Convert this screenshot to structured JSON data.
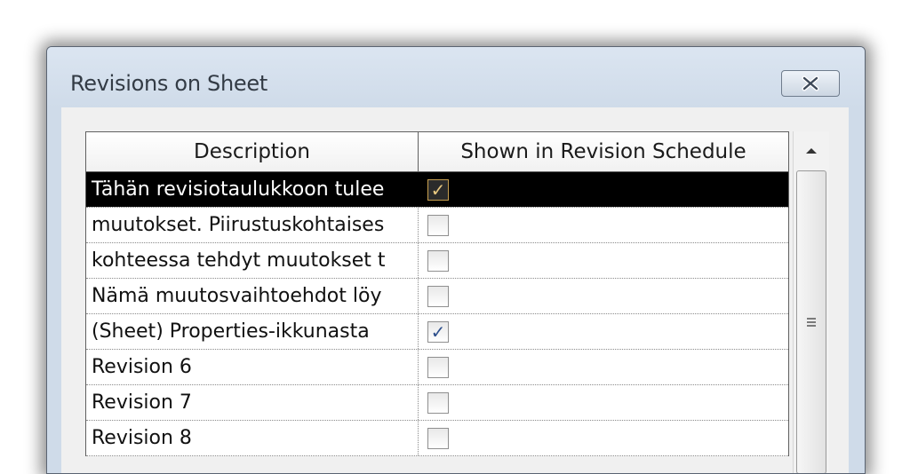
{
  "window": {
    "title": "Revisions on Sheet",
    "close_icon": "close-x-icon"
  },
  "table": {
    "headers": {
      "description": "Description",
      "shown": "Shown in Revision Schedule"
    },
    "rows": [
      {
        "description": "Tähän revisiotaulukkoon tulee",
        "checked": true,
        "selected": true
      },
      {
        "description": "muutokset. Piirustuskohtaises",
        "checked": false,
        "selected": false
      },
      {
        "description": "kohteessa tehdyt muutokset t",
        "checked": false,
        "selected": false
      },
      {
        "description": "Nämä muutosvaihtoehdot löy",
        "checked": false,
        "selected": false
      },
      {
        "description": "(Sheet) Properties-ikkunasta",
        "checked": true,
        "selected": false
      },
      {
        "description": "Revision 6",
        "checked": false,
        "selected": false
      },
      {
        "description": "Revision 7",
        "checked": false,
        "selected": false
      },
      {
        "description": "Revision 8",
        "checked": false,
        "selected": false
      }
    ]
  },
  "scrollbar": {
    "up_icon": "scroll-up-arrow-icon",
    "grip_icon": "scroll-grip-icon"
  },
  "colors": {
    "selection": "#000000",
    "check": "#2d4f8c",
    "dialog_frame": "#cfdbe9"
  }
}
